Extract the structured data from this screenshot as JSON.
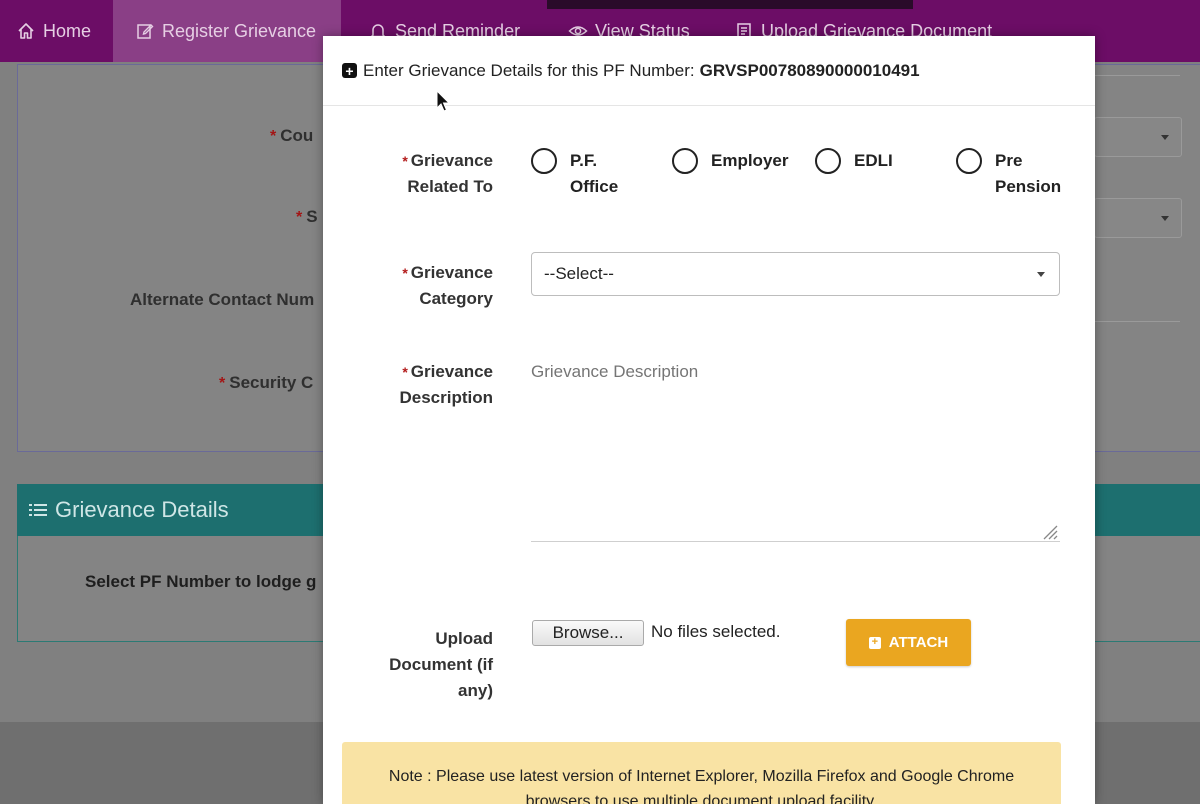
{
  "nav": {
    "items": [
      {
        "label": "Home",
        "icon": "home-icon"
      },
      {
        "label": "Register Grievance",
        "icon": "edit-icon"
      },
      {
        "label": "Send Reminder",
        "icon": "bell-icon"
      },
      {
        "label": "View Status",
        "icon": "eye-icon"
      },
      {
        "label": "Upload Grievance Document",
        "icon": "document-icon"
      }
    ]
  },
  "background": {
    "labels": {
      "country": "Cou",
      "state": "S",
      "alternate_contact": "Alternate Contact Num",
      "security_code": "Security C"
    },
    "grievance_details": {
      "title": "Grievance Details",
      "text": "Select PF Number to lodge g"
    }
  },
  "modal": {
    "header_prefix": "Enter Grievance Details for this PF Number:",
    "pf_number": "GRVSP00780890000010491",
    "related_to": {
      "label_line1": "Grievance",
      "label_line2": "Related To",
      "options": [
        {
          "line1": "P.F.",
          "line2": "Office"
        },
        {
          "line1": "Employer",
          "line2": ""
        },
        {
          "line1": "EDLI",
          "line2": ""
        },
        {
          "line1": "Pre",
          "line2": "Pension"
        }
      ]
    },
    "category": {
      "label_line1": "Grievance",
      "label_line2": "Category",
      "selected": "--Select--"
    },
    "description": {
      "label_line1": "Grievance",
      "label_line2": "Description",
      "placeholder": "Grievance Description"
    },
    "upload": {
      "label_line1": "Upload",
      "label_line2": "Document (if",
      "label_line3": "any)",
      "browse_label": "Browse...",
      "file_status": "No files selected.",
      "attach_label": "ATTACH"
    },
    "note": "Note : Please use latest version of Internet Explorer, Mozilla Firefox and Google Chrome browsers to use multiple document upload facility."
  },
  "colors": {
    "nav_bg": "#6c0d66",
    "nav_active": "#8a3f86",
    "teal_header": "#1d6f6f",
    "attach_button": "#eaa620",
    "note_bg": "#f9e3a4",
    "required_star": "#b31b1b"
  }
}
